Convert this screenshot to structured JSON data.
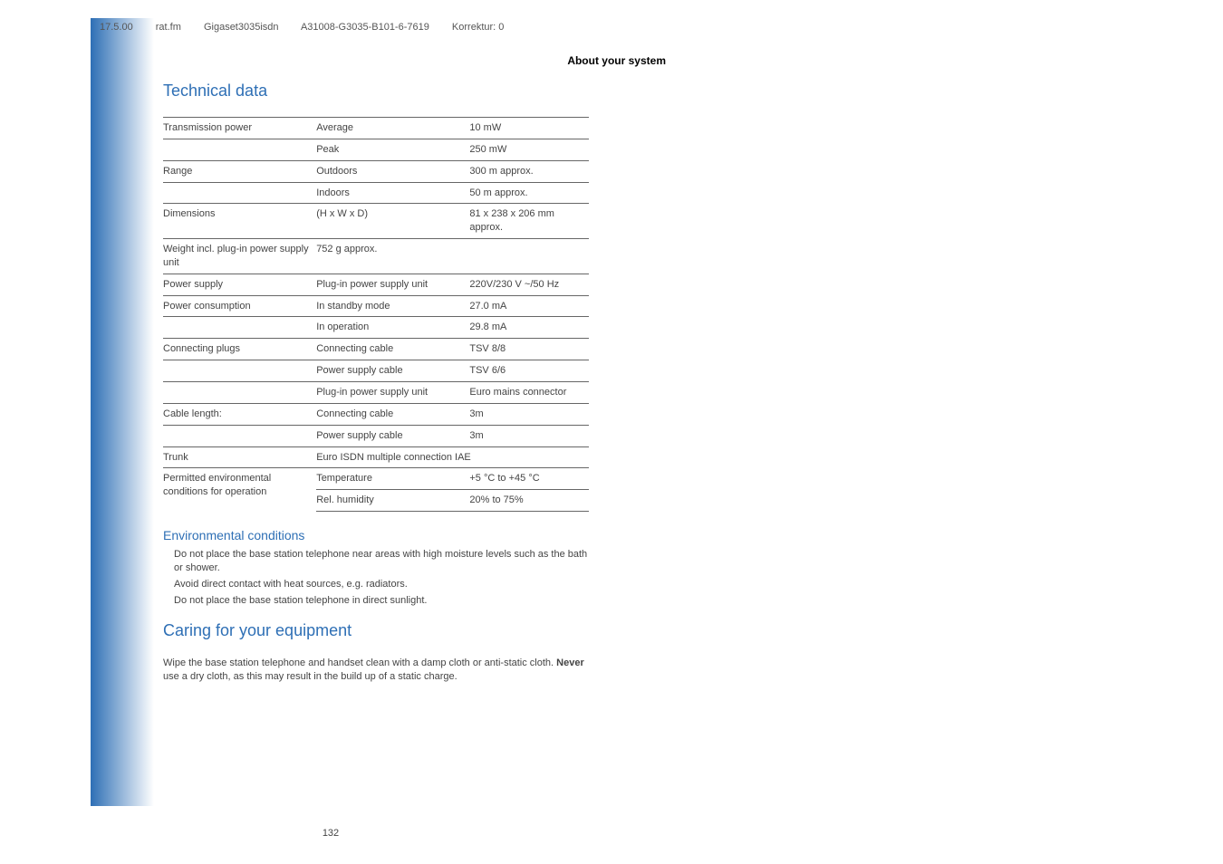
{
  "header": {
    "date": "17.5.00",
    "file": "rat.fm",
    "product": "Gigaset3035isdn",
    "partno": "A31008-G3035-B101-6-7619",
    "korrektur": "Korrektur: 0"
  },
  "section_title": "About your system",
  "technical_data_heading": "Technical data",
  "rows": [
    {
      "c1": "Transmission power",
      "c2": "Average",
      "c3": "10 mW"
    },
    {
      "c1": "",
      "c2": "Peak",
      "c3": "250 mW"
    },
    {
      "c1": "Range",
      "c2": "Outdoors",
      "c3": "300 m approx."
    },
    {
      "c1": "",
      "c2": "Indoors",
      "c3": "50 m approx."
    },
    {
      "c1": "Dimensions",
      "c2": "(H x W x D)",
      "c3": "81 x 238 x 206 mm approx."
    },
    {
      "c1": "Weight incl. plug-in power supply unit",
      "c2": "752 g approx.",
      "c3": ""
    },
    {
      "c1": "Power supply",
      "c2": "Plug-in power supply unit",
      "c3": "220V/230 V ~/50 Hz"
    },
    {
      "c1": "Power consumption",
      "c2": "In standby mode",
      "c3": "27.0 mA"
    },
    {
      "c1": "",
      "c2": "In operation",
      "c3": "29.8 mA"
    },
    {
      "c1": "Connecting plugs",
      "c2": "Connecting cable",
      "c3": "TSV 8/8"
    },
    {
      "c1": "",
      "c2": "Power supply cable",
      "c3": "TSV 6/6"
    },
    {
      "c1": "",
      "c2": "Plug-in power supply unit",
      "c3": "Euro mains connector"
    },
    {
      "c1": "Cable length:",
      "c2": "Connecting cable",
      "c3": "3m"
    },
    {
      "c1": "",
      "c2": "Power supply cable",
      "c3": "3m"
    },
    {
      "c1": "Trunk",
      "c2": "Euro ISDN multiple connection IAE",
      "c3": "",
      "span": true
    },
    {
      "c1": "Permitted environmental conditions for operation",
      "c2": "Temperature",
      "c3": "+5 °C to +45 °C",
      "rowspan": 2
    },
    {
      "c1": "",
      "c2": "Rel. humidity",
      "c3": "20% to 75%",
      "skipc1": true
    }
  ],
  "env_heading": "Environmental conditions",
  "env_bullets": [
    "Do not place the base station telephone near areas with high moisture levels such as the bath or shower.",
    "Avoid direct contact with heat sources, e.g. radiators.",
    "Do not place the base station telephone in direct sunlight."
  ],
  "caring_heading": "Caring for your equipment",
  "caring_text_pre": "Wipe the base station telephone and handset clean with a damp cloth or anti-static cloth. ",
  "caring_bold": "Never",
  "caring_text_post": " use a dry cloth, as this may result in the build up of a static charge.",
  "page_number": "132"
}
